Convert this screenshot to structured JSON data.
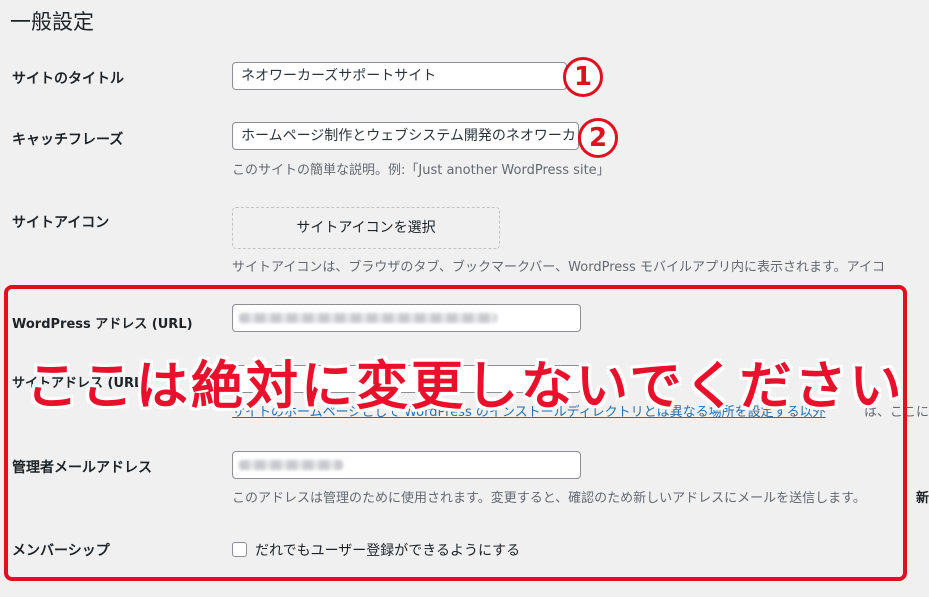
{
  "page": {
    "title": "一般設定"
  },
  "fields": {
    "site_title": {
      "label": "サイトのタイトル",
      "value": "ネオワーカーズサポートサイト",
      "marker": "1"
    },
    "tagline": {
      "label": "キャッチフレーズ",
      "value": "ホームページ制作とウェブシステム開発のネオワーカ",
      "description": "このサイトの簡単な説明。例:「Just another WordPress site」",
      "marker": "2"
    },
    "site_icon": {
      "label": "サイトアイコン",
      "button_label": "サイトアイコンを選択",
      "description": "サイトアイコンは、ブラウザのタブ、ブックマークバー、WordPress モバイルアプリ内に表示されます。アイコ"
    },
    "wp_address": {
      "label": "WordPress アドレス (URL)"
    },
    "site_address": {
      "label": "サイトアドレス (URL)",
      "link_text": "サイトのホームページとして WordPress のインストールディレクトリとは異なる場所を設定する以外",
      "link_tail": "は、ここに"
    },
    "admin_email": {
      "label": "管理者メールアドレス",
      "description": "このアドレスは管理のために使用されます。変更すると、確認のため新しいアドレスにメールを送信します。",
      "description_tail": "新"
    },
    "membership": {
      "label": "メンバーシップ",
      "checkbox_label": "だれでもユーザー登録ができるようにする",
      "checked": false
    }
  },
  "annotation": {
    "warning_text": "ここは絶対に変更しないでください",
    "color": "#e0101f"
  }
}
